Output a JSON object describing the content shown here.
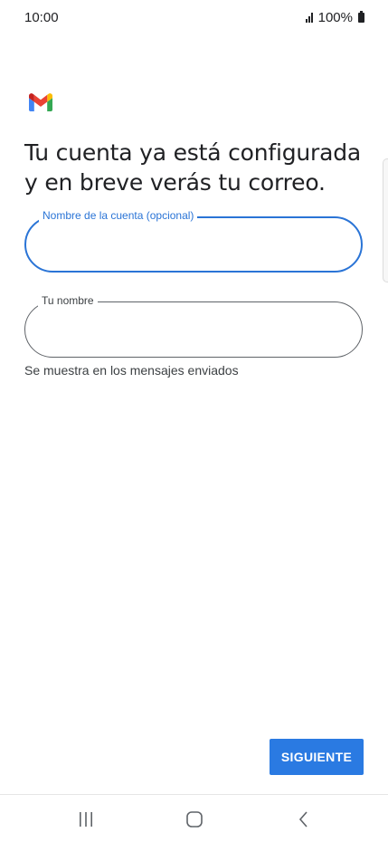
{
  "status_bar": {
    "time": "10:00",
    "battery": "100%"
  },
  "app": {
    "logo": "gmail-logo"
  },
  "headline": "Tu cuenta ya está configurada y en breve verás tu correo.",
  "form": {
    "account_name": {
      "label": "Nombre de la cuenta (opcional)",
      "value": ""
    },
    "your_name": {
      "label": "Tu nombre",
      "value": "",
      "helper": "Se muestra en los mensajes enviados"
    }
  },
  "actions": {
    "next_label": "SIGUIENTE"
  },
  "navigation": {
    "recents_icon": "recents-icon",
    "home_icon": "home-icon",
    "back_icon": "back-icon"
  },
  "colors": {
    "accent": "#2a74d6",
    "button": "#2a7ae2",
    "text": "#202124"
  }
}
